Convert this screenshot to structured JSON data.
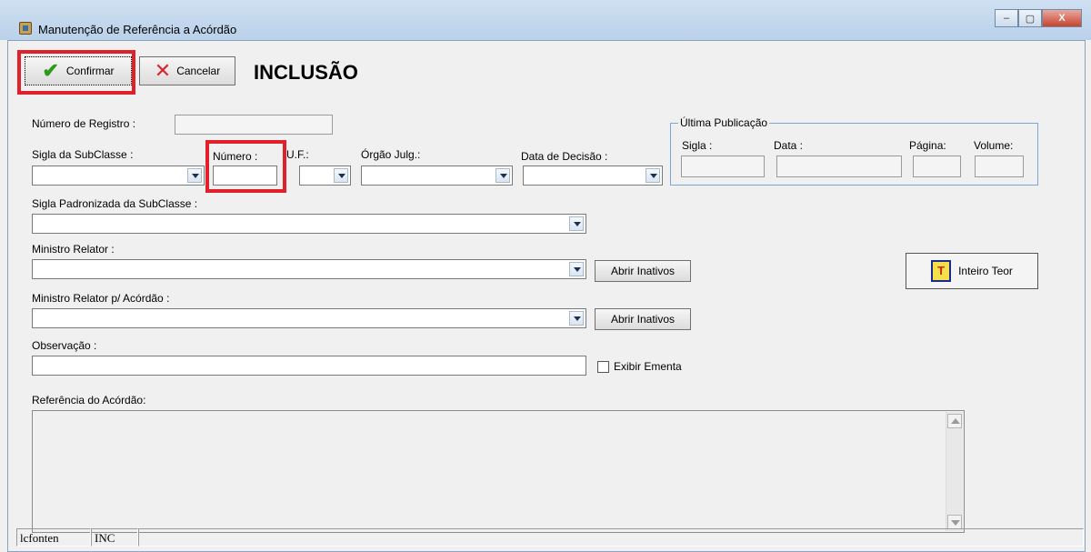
{
  "window": {
    "title": "Manutenção de Referência a Acórdão",
    "minimize": "–",
    "maximize": "▢",
    "close": "X"
  },
  "toolbar": {
    "confirm_label": "Confirmar",
    "cancel_label": "Cancelar",
    "mode": "INCLUSÃO"
  },
  "form": {
    "numero_registro_label": "Número de Registro :",
    "sigla_subclasse_label": "Sigla da SubClasse :",
    "numero_label": "Número :",
    "uf_label": "U.F.:",
    "orgao_label": "Órgão Julg.:",
    "data_decisao_label": "Data de Decisão :",
    "sigla_padronizada_label": "Sigla Padronizada da SubClasse :",
    "ministro_relator_label": "Ministro Relator :",
    "ministro_relator_acordao_label": "Ministro Relator p/ Acórdão :",
    "observacao_label": "Observação :",
    "referencia_label": "Referência do Acórdão:",
    "abrir_inativos_1": "Abrir Inativos",
    "abrir_inativos_2": "Abrir Inativos",
    "exibir_ementa_label": "Exibir Ementa",
    "inteiro_teor_label": "Inteiro Teor"
  },
  "ultima_publicacao": {
    "title": "Última Publicação",
    "sigla": "Sigla :",
    "data": "Data :",
    "pagina": "Página:",
    "volume": "Volume:"
  },
  "statusbar": {
    "panel1": "lcfonten",
    "panel2": "INC",
    "panel3": ""
  },
  "colors": {
    "highlight": "#e0202a",
    "title_gradient_top": "#cfe0f1"
  }
}
